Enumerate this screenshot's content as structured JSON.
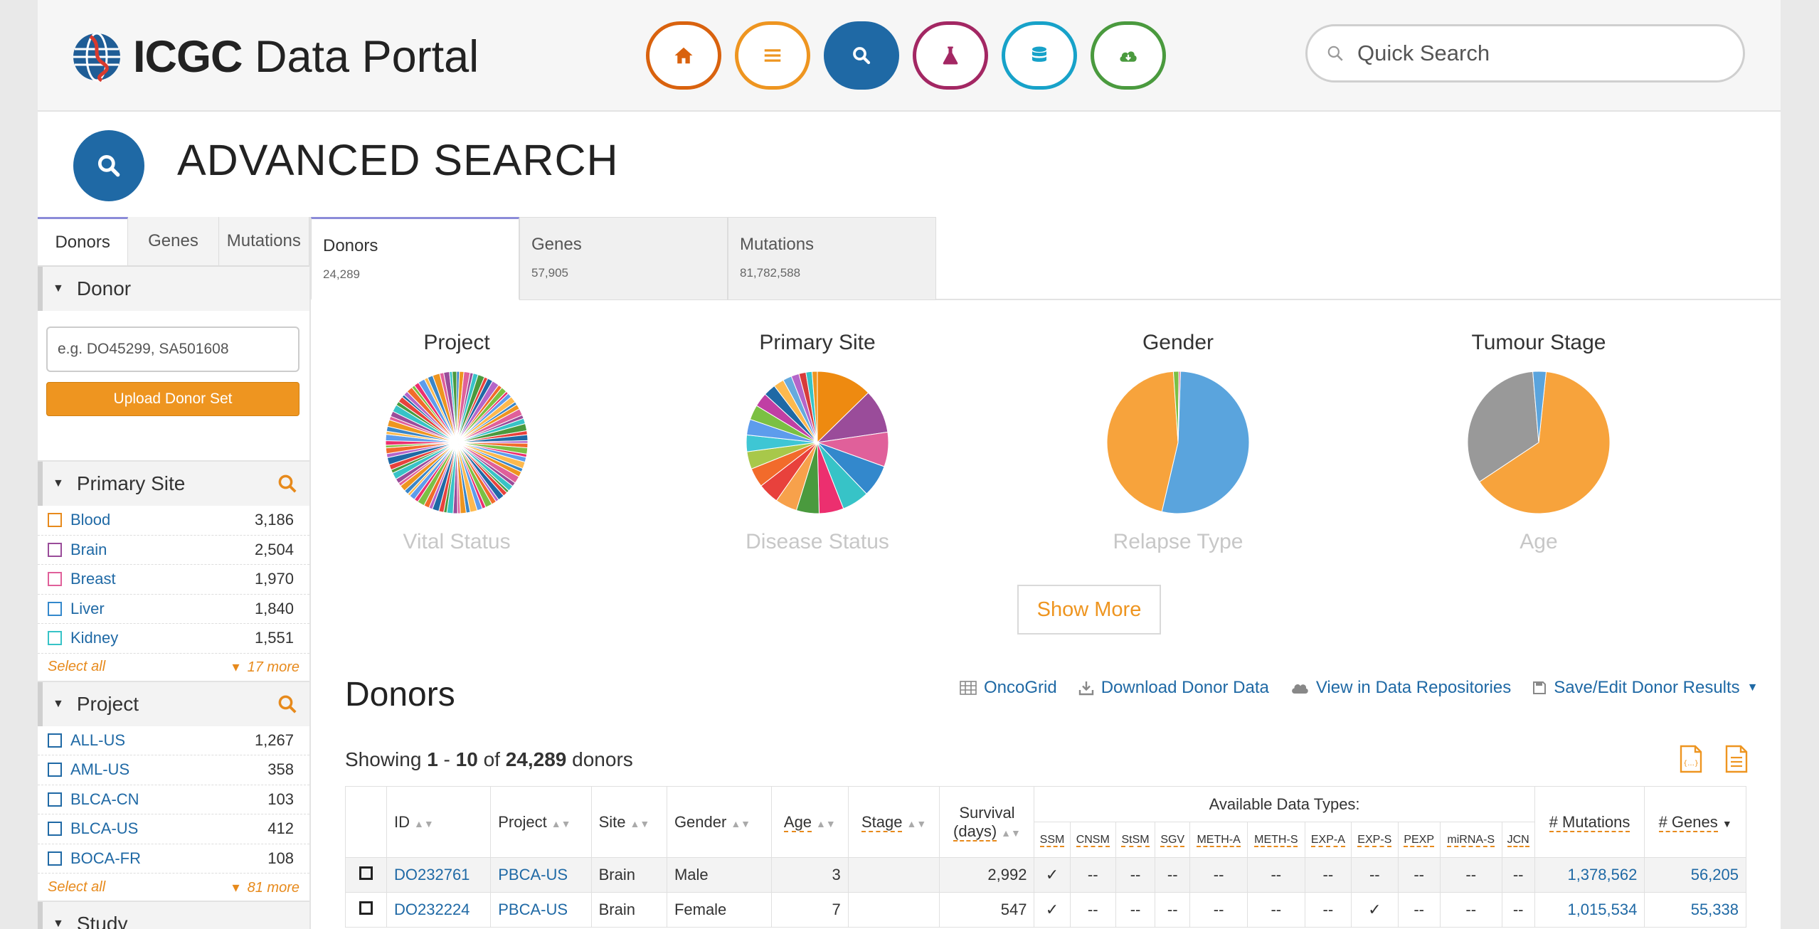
{
  "header": {
    "logo_bold": "ICGC",
    "logo_rest": " Data Portal",
    "quick_search_placeholder": "Quick Search",
    "nav": [
      {
        "name": "home",
        "color": "#d9620e"
      },
      {
        "name": "projects",
        "color": "#ee9520"
      },
      {
        "name": "advanced-search",
        "color": "#1f69a5"
      },
      {
        "name": "analysis",
        "color": "#a32763"
      },
      {
        "name": "data-repositories",
        "color": "#17a2c9"
      },
      {
        "name": "data-releases",
        "color": "#4a9a3e"
      }
    ]
  },
  "page": {
    "title": "ADVANCED SEARCH"
  },
  "sidebar": {
    "tabs": [
      "Donors",
      "Genes",
      "Mutations"
    ],
    "donor": {
      "heading": "Donor",
      "input_placeholder": "e.g. DO45299, SA501608",
      "upload_label": "Upload Donor Set"
    },
    "primary_site": {
      "heading": "Primary Site",
      "items": [
        {
          "label": "Blood",
          "count": "3,186",
          "color": "#e78a1c"
        },
        {
          "label": "Brain",
          "count": "2,504",
          "color": "#9a4c9a"
        },
        {
          "label": "Breast",
          "count": "1,970",
          "color": "#e0609a"
        },
        {
          "label": "Liver",
          "count": "1,840",
          "color": "#3388cc"
        },
        {
          "label": "Kidney",
          "count": "1,551",
          "color": "#37c3c7"
        }
      ],
      "select_all": "Select all",
      "more": "17 more"
    },
    "project": {
      "heading": "Project",
      "items": [
        {
          "label": "ALL-US",
          "count": "1,267",
          "color": "#1f69a5"
        },
        {
          "label": "AML-US",
          "count": "358",
          "color": "#1f69a5"
        },
        {
          "label": "BLCA-CN",
          "count": "103",
          "color": "#1f69a5"
        },
        {
          "label": "BLCA-US",
          "count": "412",
          "color": "#1f69a5"
        },
        {
          "label": "BOCA-FR",
          "count": "108",
          "color": "#1f69a5"
        }
      ],
      "select_all": "Select all",
      "more": "81 more"
    },
    "study_heading": "Study"
  },
  "main": {
    "tabs": [
      {
        "label": "Donors",
        "count": "24,289"
      },
      {
        "label": "Genes",
        "count": "57,905"
      },
      {
        "label": "Mutations",
        "count": "81,782,588"
      }
    ],
    "charts": [
      {
        "title": "Project",
        "next": "Vital Status"
      },
      {
        "title": "Primary Site",
        "next": "Disease Status"
      },
      {
        "title": "Gender",
        "next": "Relapse Type"
      },
      {
        "title": "Tumour Stage",
        "next": "Age"
      }
    ],
    "show_more": "Show More",
    "donors_title": "Donors",
    "actions": [
      "OncoGrid",
      "Download Donor Data",
      "View in Data Repositories",
      "Save/Edit Donor Results"
    ],
    "showing": {
      "prefix": "Showing ",
      "from": "1",
      "sep": " - ",
      "to": "10",
      "of": " of ",
      "total": "24,289",
      "suffix": " donors"
    }
  },
  "chart_data": [
    {
      "type": "pie",
      "title": "Project",
      "slice_count": 90,
      "palette": [
        "#3a86c8",
        "#ee9520",
        "#e0609a",
        "#9a4c9a",
        "#37c3c7",
        "#4a9a3e",
        "#e8413c",
        "#1f69a5",
        "#b565c9",
        "#f26b2b",
        "#7bc043",
        "#ec2f6f",
        "#5d9cec",
        "#fdb94e"
      ]
    },
    {
      "type": "pie",
      "title": "Primary Site",
      "values": [
        3186,
        2504,
        1970,
        1840,
        1551,
        1400,
        1300,
        1250,
        1200,
        1100,
        1000,
        950,
        900,
        850,
        800,
        700,
        600,
        500,
        450,
        400,
        350,
        300
      ],
      "colors": [
        "#ee8a10",
        "#9a4c9a",
        "#e0609a",
        "#3388cc",
        "#37c3c7",
        "#ec2f6f",
        "#4a9a3e",
        "#f7a14b",
        "#e8413c",
        "#f26b2b",
        "#a8c84a",
        "#3ec6d4",
        "#5d9cec",
        "#7bc043",
        "#c03fa4",
        "#1f69a5",
        "#fdb94e",
        "#66aadd",
        "#b565c9",
        "#d73b3b",
        "#37c3c7",
        "#ee9520"
      ]
    },
    {
      "type": "pie",
      "title": "Gender",
      "values": [
        12900,
        11000,
        300,
        89
      ],
      "colors": [
        "#5aa4dd",
        "#f7a33c",
        "#7bc043",
        "#e0609a"
      ]
    },
    {
      "type": "pie",
      "title": "Tumour Stage",
      "values": [
        64,
        33,
        3
      ],
      "colors": [
        "#f7a33c",
        "#999999",
        "#5aa4dd"
      ]
    }
  ],
  "table": {
    "headers": {
      "id": "ID",
      "project": "Project",
      "site": "Site",
      "gender": "Gender",
      "age": "Age",
      "stage": "Stage",
      "survival": "Survival",
      "survival_unit": "(days)",
      "available": "Available Data Types:",
      "mutations": "# Mutations",
      "genes": "# Genes"
    },
    "data_types": [
      "SSM",
      "CNSM",
      "StSM",
      "SGV",
      "METH-A",
      "METH-S",
      "EXP-A",
      "EXP-S",
      "PEXP",
      "miRNA-S",
      "JCN"
    ],
    "rows": [
      {
        "id": "DO232761",
        "project": "PBCA-US",
        "site": "Brain",
        "gender": "Male",
        "age": "3",
        "stage": "",
        "survival": "2,992",
        "types": [
          "✓",
          "--",
          "--",
          "--",
          "--",
          "--",
          "--",
          "--",
          "--",
          "--",
          "--"
        ],
        "mutations": "1,378,562",
        "genes": "56,205"
      },
      {
        "id": "DO232224",
        "project": "PBCA-US",
        "site": "Brain",
        "gender": "Female",
        "age": "7",
        "stage": "",
        "survival": "547",
        "types": [
          "✓",
          "--",
          "--",
          "--",
          "--",
          "--",
          "--",
          "✓",
          "--",
          "--",
          "--"
        ],
        "mutations": "1,015,534",
        "genes": "55,338"
      }
    ]
  }
}
